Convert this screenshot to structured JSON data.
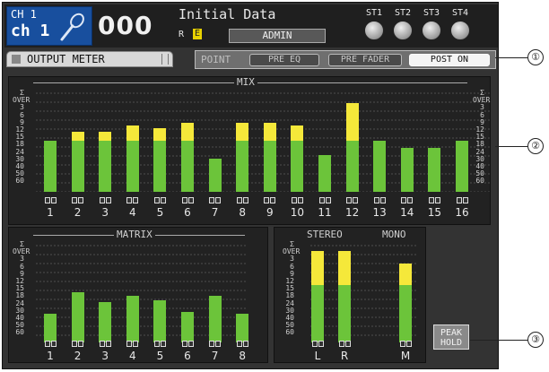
{
  "header": {
    "ch_line1": "CH 1",
    "ch_line2": "ch 1",
    "scene_number": "000",
    "scene_title": "Initial Data",
    "r_flag": "R",
    "e_flag": "E",
    "access_level": "ADMIN",
    "st_labels": [
      "ST1",
      "ST2",
      "ST3",
      "ST4"
    ]
  },
  "tab": {
    "label": "OUTPUT METER"
  },
  "point": {
    "label": "POINT",
    "options": [
      "PRE EQ",
      "PRE FADER",
      "POST ON"
    ],
    "selected": "POST ON"
  },
  "scale_labels": [
    "Σ",
    "OVER",
    "3",
    "6",
    "9",
    "12",
    "15",
    "18",
    "24",
    "30",
    "40",
    "50",
    "60"
  ],
  "mix": {
    "title": "MIX",
    "channels": [
      "1",
      "2",
      "3",
      "4",
      "5",
      "6",
      "7",
      "8",
      "9",
      "10",
      "11",
      "12",
      "13",
      "14",
      "15",
      "16"
    ],
    "levels_green": [
      0.5,
      0.5,
      0.5,
      0.5,
      0.5,
      0.5,
      0.32,
      0.5,
      0.5,
      0.5,
      0.36,
      0.5,
      0.5,
      0.43,
      0.43,
      0.5
    ],
    "levels_yellow": [
      0.0,
      0.08,
      0.08,
      0.14,
      0.12,
      0.17,
      0.0,
      0.17,
      0.17,
      0.14,
      0.0,
      0.36,
      0.0,
      0.0,
      0.0,
      0.0
    ]
  },
  "matrix": {
    "title": "MATRIX",
    "channels": [
      "1",
      "2",
      "3",
      "4",
      "5",
      "6",
      "7",
      "8"
    ],
    "levels_green": [
      0.28,
      0.5,
      0.4,
      0.46,
      0.42,
      0.3,
      0.46,
      0.28
    ],
    "levels_yellow": [
      0,
      0,
      0,
      0,
      0,
      0,
      0,
      0
    ]
  },
  "stereo_mono": {
    "title_stereo": "STEREO",
    "title_mono": "MONO",
    "channels": [
      "L",
      "R",
      "M"
    ],
    "levels_green": [
      0.57,
      0.57,
      0.57
    ],
    "levels_yellow": [
      0.33,
      0.33,
      0.21
    ]
  },
  "peak_hold": {
    "line1": "PEAK",
    "line2": "HOLD"
  },
  "callouts": [
    "①",
    "②",
    "③"
  ],
  "colors": {
    "meter_green": "#6cc43a",
    "meter_yellow": "#f5e83a",
    "channel_box": "#184f9e",
    "screen_bg": "#333333"
  }
}
